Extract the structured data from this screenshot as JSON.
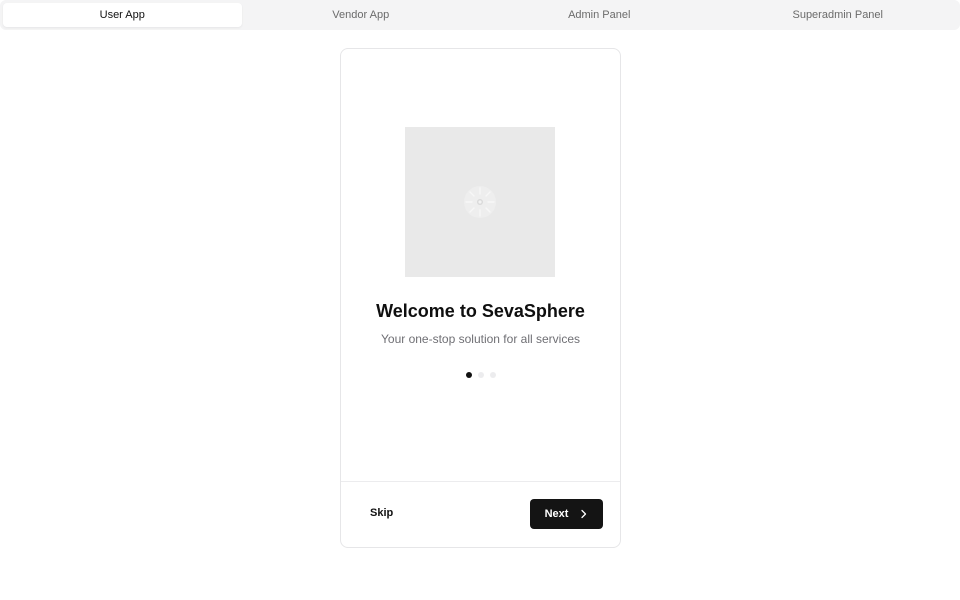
{
  "tabs": [
    {
      "label": "User App",
      "active": true
    },
    {
      "label": "Vendor App",
      "active": false
    },
    {
      "label": "Admin Panel",
      "active": false
    },
    {
      "label": "Superadmin Panel",
      "active": false
    }
  ],
  "onboarding": {
    "image_icon": "loading-spinner-icon",
    "title": "Welcome to SevaSphere",
    "subtitle": "Your one-stop solution for all services",
    "pagination": {
      "current": 1,
      "total": 3
    },
    "skip_label": "Skip",
    "next_label": "Next",
    "next_icon": "chevron-right-icon"
  },
  "colors": {
    "primary_button": "#141414",
    "active_dot": "#111111",
    "inactive_dot": "#ececee"
  }
}
